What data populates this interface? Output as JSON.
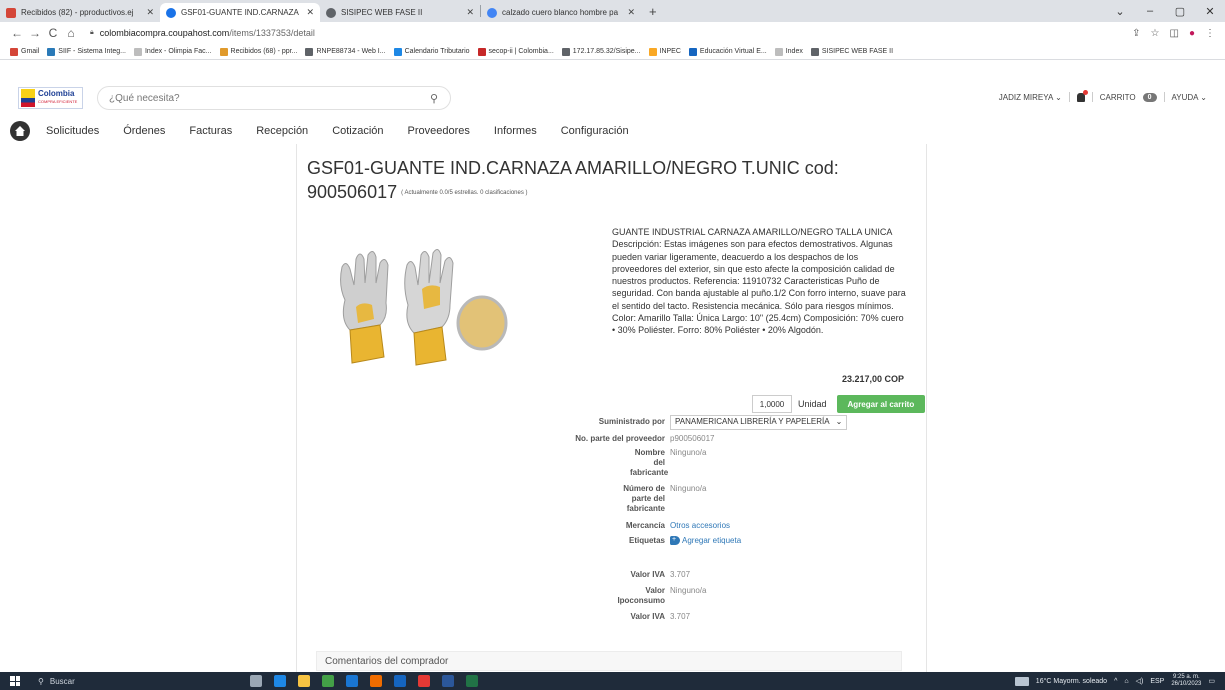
{
  "browser": {
    "tabs": [
      {
        "title": "Recibidos (82) - pproductivos.ej",
        "favicon_color": "#d44638",
        "active": false
      },
      {
        "title": "GSF01-GUANTE IND.CARNAZA",
        "favicon_color": "#1a73e8",
        "active": true
      },
      {
        "title": "SISIPEC WEB FASE II",
        "favicon_color": "#5f6368",
        "active": false
      },
      {
        "title": "calzado cuero blanco hombre pa",
        "favicon_color": "#4285f4",
        "active": false
      }
    ],
    "new_tab": "+",
    "window_controls": {
      "tabsearch": "⌄",
      "minimize": "–",
      "maximize": "▢",
      "close": "✕"
    },
    "nav": {
      "back": "←",
      "forward": "→",
      "reload": "C",
      "home": "⌂"
    },
    "url_domain": "colombiacompra.coupahost.com",
    "url_path": "/items/1337353/detail",
    "addr_icons": {
      "share": "⇪",
      "star": "☆",
      "sidebar": "◫",
      "profile": "●",
      "menu": "⋮"
    },
    "bookmarks": [
      {
        "label": "Gmail",
        "color": "#d44638"
      },
      {
        "label": "SIIF - Sistema Integ...",
        "color": "#2a7ab8"
      },
      {
        "label": "Index - Olimpia Fac...",
        "color": "#bdbdbd"
      },
      {
        "label": "Recibidos (68) - ppr...",
        "color": "#e09a2c"
      },
      {
        "label": "RNPE88734 - Web I...",
        "color": "#5f6368"
      },
      {
        "label": "Calendario Tributario",
        "color": "#1e88e5"
      },
      {
        "label": "secop-ii | Colombia...",
        "color": "#c62828"
      },
      {
        "label": "172.17.85.32/Sisipe...",
        "color": "#5f6368"
      },
      {
        "label": "INPEC",
        "color": "#f9a825"
      },
      {
        "label": "Educación Virtual E...",
        "color": "#1565c0"
      },
      {
        "label": "Index",
        "color": "#bdbdbd"
      },
      {
        "label": "SISIPEC WEB FASE II",
        "color": "#5f6368"
      }
    ]
  },
  "header": {
    "logo_name": "Colombia",
    "logo_sub": "COMPRA EFICIENTE",
    "search_placeholder": "¿Qué necesita?",
    "user": "JADIZ MIREYA ⌄",
    "cart_label": "CARRITO",
    "cart_count": "0",
    "help": "AYUDA ⌄"
  },
  "nav": [
    "Solicitudes",
    "Órdenes",
    "Facturas",
    "Recepción",
    "Cotización",
    "Proveedores",
    "Informes",
    "Configuración"
  ],
  "product": {
    "title": "GSF01-GUANTE IND.CARNAZA AMARILLO/NEGRO T.UNIC cod: 900506017",
    "rating": "( Actualmente 0.0/5 estrellas. 0 clasificaciones )",
    "description": "GUANTE INDUSTRIAL CARNAZA AMARILLO/NEGRO TALLA UNICA Descripción: Estas imágenes son para efectos demostrativos. Algunas pueden variar ligeramente, deacuerdo a los despachos de los proveedores del exterior, sin que esto afecte la composición calidad de nuestros productos. Referencia: 11910732 Caracteristicas Puño de seguridad. Con banda ajustable al puño.1/2 Con forro interno, suave para el sentido del tacto. Resistencia mecánica. Sólo para riesgos mínimos. Color: Amarillo Talla: Única Largo: 10\" (25.4cm) Composición: 70% cuero • 30% Poliéster. Forro: 80% Poliéster • 20% Algodón.",
    "price": "23.217,00 COP",
    "quantity": "1,0000",
    "unit": "Unidad",
    "add_to_cart": "Agregar al carrito"
  },
  "details": {
    "supplied_by_label": "Suministrado por",
    "supplied_by_value": "PANAMERICANA LIBRERÍA Y PAPELERÍA",
    "supplier_part_label": "No. parte del proveedor",
    "supplier_part_value": "p900506017",
    "manufacturer_label": "Nombre del fabricante",
    "manufacturer_value": "Ninguno/a",
    "manufacturer_part_label": "Número de parte del fabricante",
    "manufacturer_part_value": "Ninguno/a",
    "commodity_label": "Mercancía",
    "commodity_value": "Otros accesorios",
    "tags_label": "Etiquetas",
    "tags_value": "Agregar etiqueta",
    "iva_label": "Valor IVA",
    "iva_value": "3.707",
    "ipoconsumo_label": "Valor Ipoconsumo",
    "ipoconsumo_value": "Ninguno/a",
    "iva2_label": "Valor IVA",
    "iva2_value": "3.707"
  },
  "comments_title": "Comentarios del comprador",
  "taskbar": {
    "search": "Buscar",
    "weather": "16°C  Mayorm. soleado",
    "lang": "ESP",
    "time": "9:25 a. m.",
    "date": "26/10/2023",
    "apps": [
      "#9aa7b4",
      "#1e88e5",
      "#f6c343",
      "#43a047",
      "#1976d2",
      "#ef6c00",
      "#1565c0",
      "#e53935",
      "#2b579a",
      "#217346"
    ]
  }
}
